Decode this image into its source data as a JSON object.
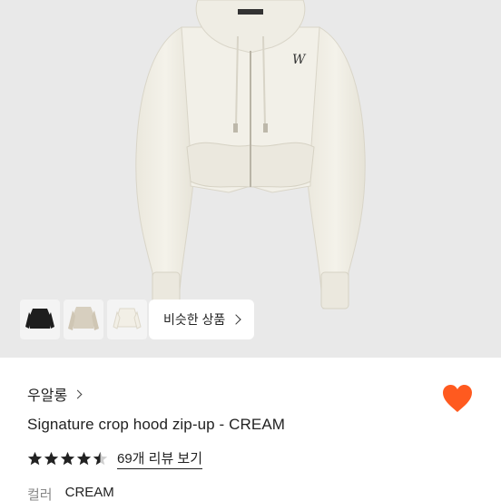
{
  "similar_button": {
    "label": "비슷한 상품"
  },
  "brand": {
    "name": "우알롱"
  },
  "product": {
    "title": "Signature crop hood zip-up - CREAM"
  },
  "rating": {
    "stars": 4.5,
    "max": 5,
    "review_link": "69개 리뷰 보기"
  },
  "color": {
    "label": "컬러",
    "value": "CREAM"
  },
  "colors": {
    "accent": "#ff5a1f",
    "hero_bg": "#e9e9e9",
    "garment": "#f1efe6",
    "star": "#222222"
  },
  "icons": {
    "favorite": "heart-icon",
    "more": "chevron-right-icon"
  }
}
